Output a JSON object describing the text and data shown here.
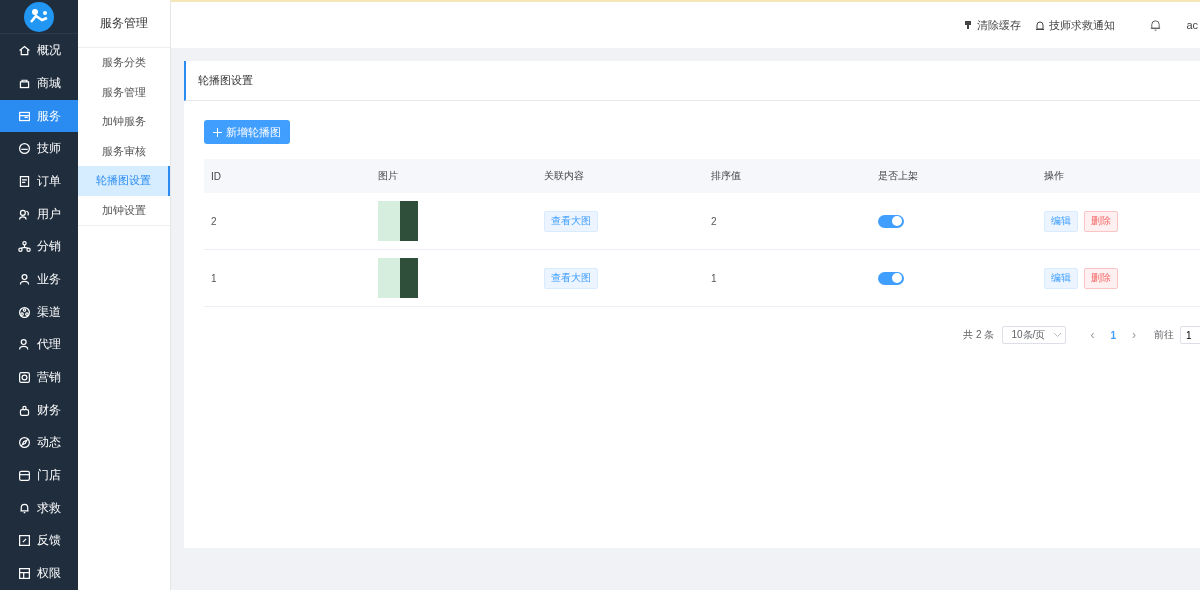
{
  "nav": {
    "items": [
      {
        "label": "概况",
        "selected": false
      },
      {
        "label": "商城",
        "selected": false
      },
      {
        "label": "服务",
        "selected": true
      },
      {
        "label": "技师",
        "selected": false
      },
      {
        "label": "订单",
        "selected": false
      },
      {
        "label": "用户",
        "selected": false
      },
      {
        "label": "分销",
        "selected": false
      },
      {
        "label": "业务",
        "selected": false
      },
      {
        "label": "渠道",
        "selected": false
      },
      {
        "label": "代理",
        "selected": false
      },
      {
        "label": "营销",
        "selected": false
      },
      {
        "label": "财务",
        "selected": false
      },
      {
        "label": "动态",
        "selected": false
      },
      {
        "label": "门店",
        "selected": false
      },
      {
        "label": "求救",
        "selected": false
      },
      {
        "label": "反馈",
        "selected": false
      },
      {
        "label": "权限",
        "selected": false
      }
    ]
  },
  "submenu": {
    "title": "服务管理",
    "items": [
      {
        "label": "服务分类",
        "selected": false
      },
      {
        "label": "服务管理",
        "selected": false
      },
      {
        "label": "加钟服务",
        "selected": false
      },
      {
        "label": "服务审核",
        "selected": false
      },
      {
        "label": "轮播图设置",
        "selected": true
      },
      {
        "label": "加钟设置",
        "selected": false
      }
    ]
  },
  "header": {
    "actions": [
      "清除缓存",
      "技师求救通知"
    ],
    "user": "ac"
  },
  "card": {
    "title": "轮播图设置",
    "add_button": "新增轮播图"
  },
  "table": {
    "columns": [
      "ID",
      "图片",
      "关联内容",
      "排序值",
      "是否上架",
      "操作"
    ],
    "rows": [
      {
        "id": "2",
        "view": "查看大图",
        "sort": "2",
        "on": true,
        "edit": "编辑",
        "delete": "删除"
      },
      {
        "id": "1",
        "view": "查看大图",
        "sort": "1",
        "on": true,
        "edit": "编辑",
        "delete": "删除"
      }
    ]
  },
  "pagination": {
    "total": "共 2 条",
    "page_size": "10条/页",
    "prev": "‹",
    "pages": [
      {
        "label": "1",
        "selected": true
      }
    ],
    "next": "›",
    "goto": "前往",
    "goto_value": "1"
  }
}
